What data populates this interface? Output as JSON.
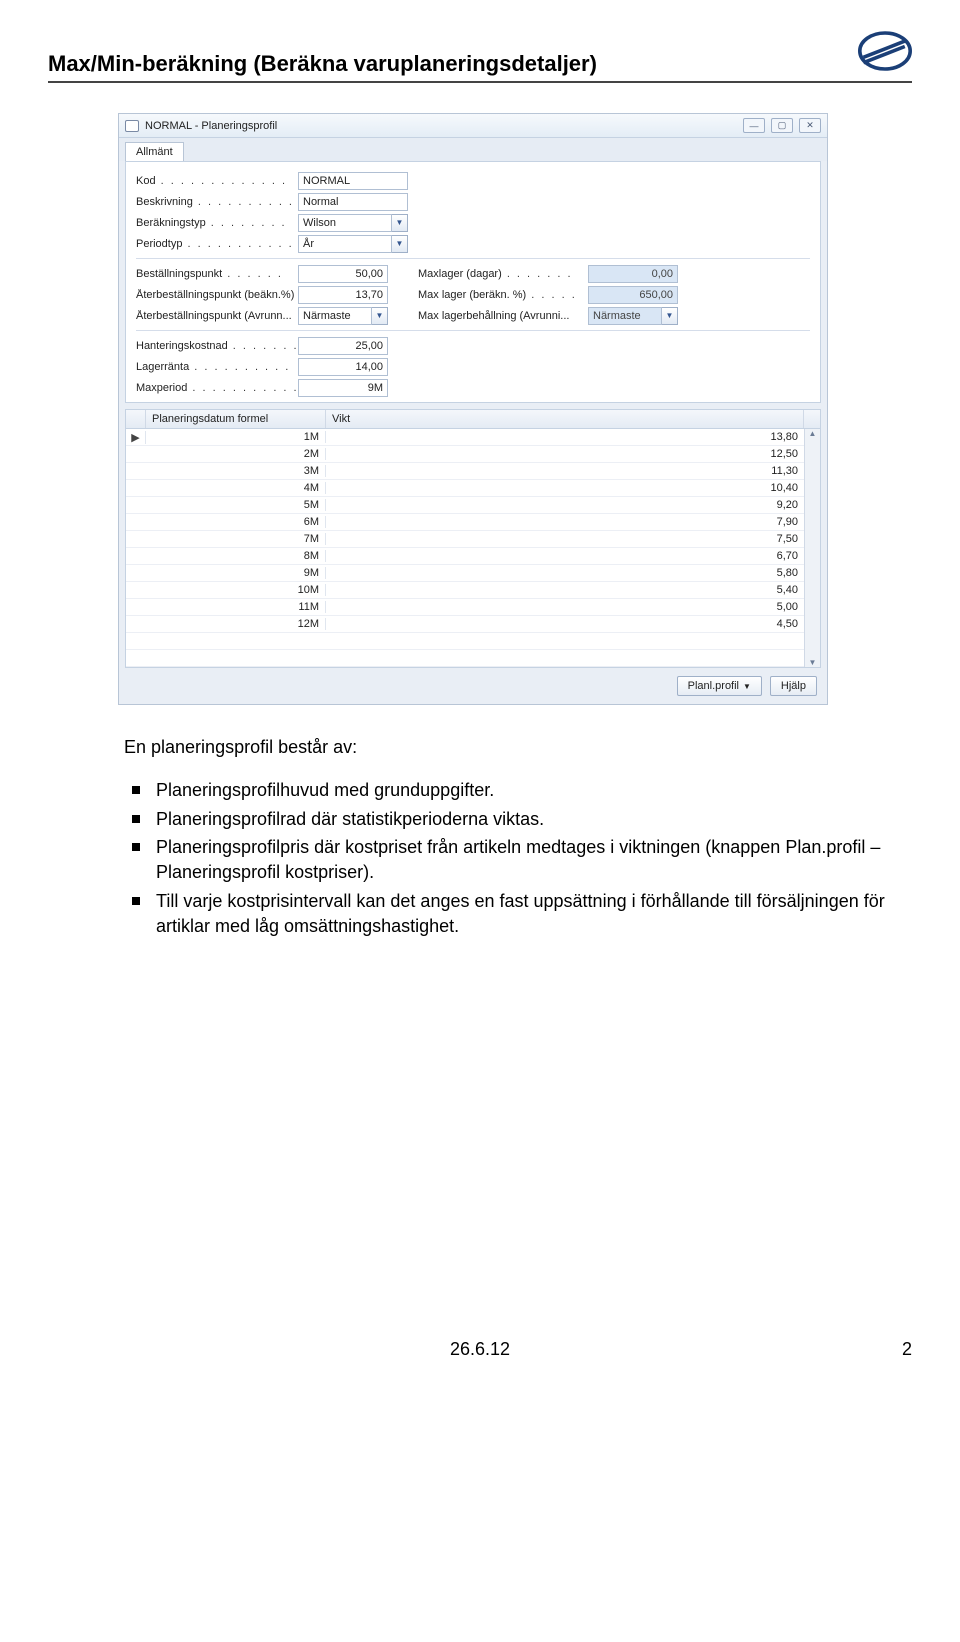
{
  "header": {
    "title": "Max/Min-beräkning (Beräkna varuplaneringsdetaljer)"
  },
  "window": {
    "title": "NORMAL - Planeringsprofil",
    "tab": "Allmänt",
    "fields_left": {
      "kod_label": "Kod",
      "kod_value": "NORMAL",
      "beskrivning_label": "Beskrivning",
      "beskrivning_value": "Normal",
      "berakningstyp_label": "Beräkningstyp",
      "berakningstyp_value": "Wilson",
      "periodtyp_label": "Periodtyp",
      "periodtyp_value": "År",
      "bestallningspunkt_label": "Beställningspunkt",
      "bestallningspunkt_value": "50,00",
      "aterbest_pct_label": "Återbeställningspunkt (beäkn.%)",
      "aterbest_pct_value": "13,70",
      "aterbest_avrunn_label": "Återbeställningspunkt (Avrunn...",
      "aterbest_avrunn_value": "Närmaste",
      "hanteringskostnad_label": "Hanteringskostnad",
      "hanteringskostnad_value": "25,00",
      "lagerranta_label": "Lagerränta",
      "lagerranta_value": "14,00",
      "maxperiod_label": "Maxperiod",
      "maxperiod_value": "9M"
    },
    "fields_right": {
      "maxlager_dager_label": "Maxlager (dagar)",
      "maxlager_dager_value": "0,00",
      "maxlager_pct_label": "Max lager (beräkn. %)",
      "maxlager_pct_value": "650,00",
      "maxlager_avrunn_label": "Max lagerbehållning (Avrunni...",
      "maxlager_avrunn_value": "Närmaste"
    },
    "grid": {
      "col_date": "Planeringsdatum formel",
      "col_vikt": "Vikt",
      "rows": [
        {
          "d": "1M",
          "v": "13,80"
        },
        {
          "d": "2M",
          "v": "12,50"
        },
        {
          "d": "3M",
          "v": "11,30"
        },
        {
          "d": "4M",
          "v": "10,40"
        },
        {
          "d": "5M",
          "v": "9,20"
        },
        {
          "d": "6M",
          "v": "7,90"
        },
        {
          "d": "7M",
          "v": "7,50"
        },
        {
          "d": "8M",
          "v": "6,70"
        },
        {
          "d": "9M",
          "v": "5,80"
        },
        {
          "d": "10M",
          "v": "5,40"
        },
        {
          "d": "11M",
          "v": "5,00"
        },
        {
          "d": "12M",
          "v": "4,50"
        }
      ]
    },
    "buttons": {
      "planlprofil": "Planl.profil",
      "hjalp": "Hjälp"
    }
  },
  "body": {
    "intro": "En planeringsprofil består av:",
    "bullets": [
      "Planeringsprofilhuvud med grunduppgifter.",
      "Planeringsprofilrad där statistikperioderna viktas.",
      "Planeringsprofilpris där kostpriset från artikeln medtages i viktningen (knappen Plan.profil – Planeringsprofil kostpriser).",
      "Till varje kostprisintervall kan det anges en fast uppsättning i förhållande till försäljningen för artiklar med låg omsättningshastighet."
    ]
  },
  "footer": {
    "date": "26.6.12",
    "page": "2"
  }
}
